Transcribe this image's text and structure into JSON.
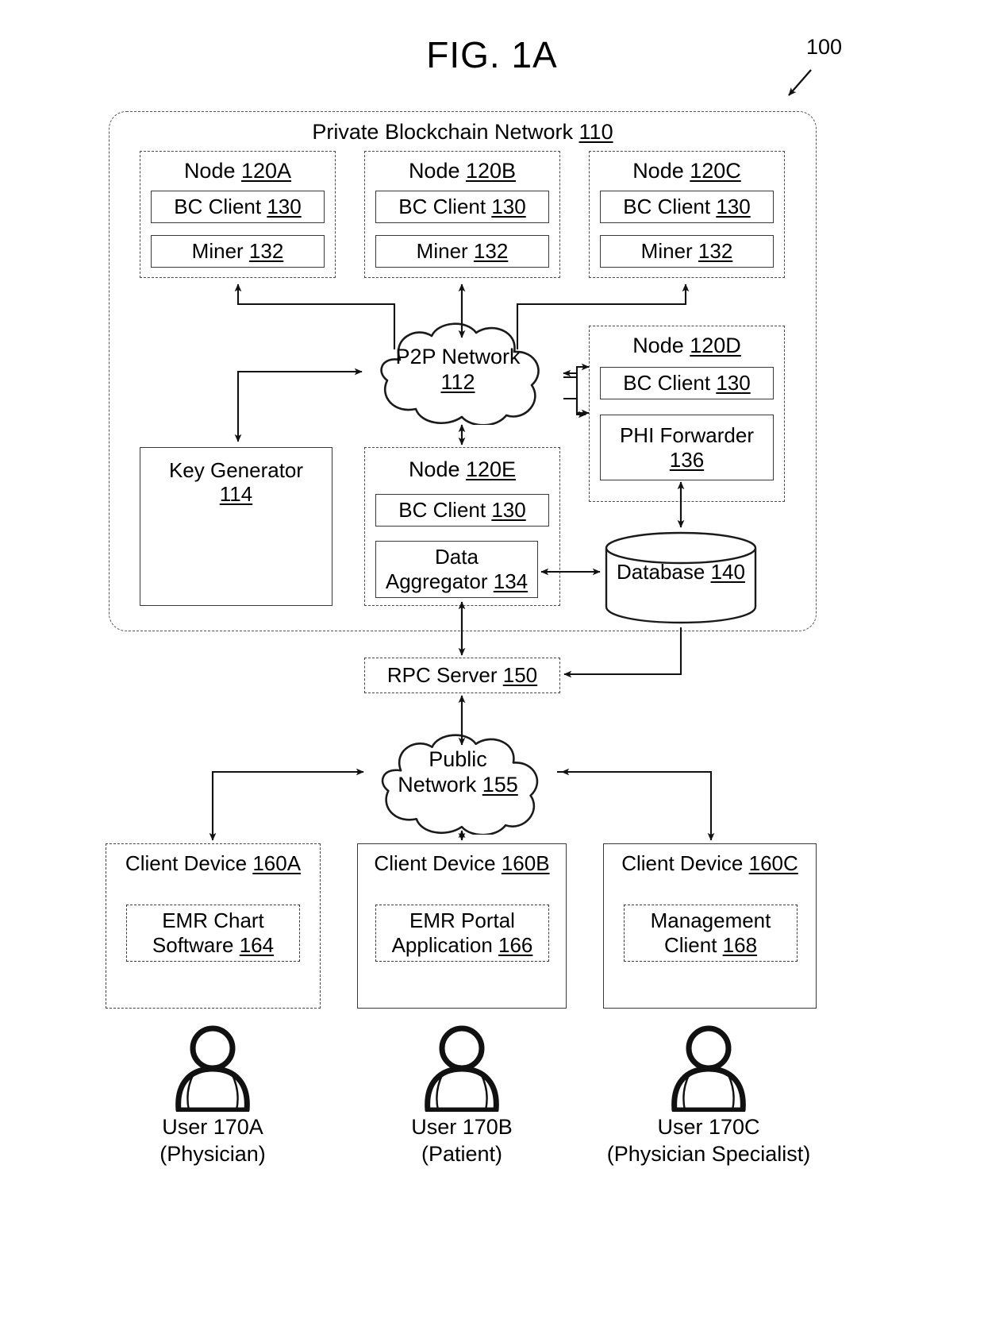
{
  "figure": {
    "title": "FIG. 1A",
    "system_ref": "100"
  },
  "private_network": {
    "label": "Private Blockchain Network ",
    "ref": "110"
  },
  "nodes": [
    {
      "id": "node-120a",
      "title": "Node ",
      "ref": "120A",
      "components": [
        {
          "label": "BC Client ",
          "ref": "130"
        },
        {
          "label": "Miner ",
          "ref": "132"
        }
      ]
    },
    {
      "id": "node-120b",
      "title": "Node ",
      "ref": "120B",
      "components": [
        {
          "label": "BC Client ",
          "ref": "130"
        },
        {
          "label": "Miner ",
          "ref": "132"
        }
      ]
    },
    {
      "id": "node-120c",
      "title": "Node ",
      "ref": "120C",
      "components": [
        {
          "label": "BC Client ",
          "ref": "130"
        },
        {
          "label": "Miner ",
          "ref": "132"
        }
      ]
    },
    {
      "id": "node-120d",
      "title": "Node ",
      "ref": "120D",
      "components": [
        {
          "label": "BC Client ",
          "ref": "130"
        },
        {
          "label": "PHI Forwarder",
          "ref": "136"
        }
      ]
    },
    {
      "id": "node-120e",
      "title": "Node ",
      "ref": "120E",
      "components": [
        {
          "label": "BC Client ",
          "ref": "130"
        },
        {
          "label": "Data Aggregator ",
          "ref": "134"
        }
      ]
    }
  ],
  "p2p_cloud": {
    "label": "P2P Network",
    "ref": "112"
  },
  "key_generator": {
    "label": "Key Generator",
    "ref": "114"
  },
  "phi_forwarder": {
    "label": "PHI Forwarder",
    "ref": "136"
  },
  "data_aggregator": {
    "line1": "Data",
    "line2": "Aggregator ",
    "ref": "134"
  },
  "database": {
    "label": "Database ",
    "ref": "140"
  },
  "rpc_server": {
    "label": "RPC Server ",
    "ref": "150"
  },
  "public_cloud": {
    "line1": "Public",
    "line2": "Network ",
    "ref": "155"
  },
  "client_devices": [
    {
      "title": "Client Device ",
      "ref": "160A",
      "app_line1": "EMR Chart",
      "app_line2": "Software ",
      "app_ref": "164",
      "user_name": "User 170A",
      "user_role": "(Physician)"
    },
    {
      "title": "Client Device ",
      "ref": "160B",
      "app_line1": "EMR Portal",
      "app_line2": "Application ",
      "app_ref": "166",
      "user_name": "User 170B",
      "user_role": "(Patient)"
    },
    {
      "title": "Client Device ",
      "ref": "160C",
      "app_line1": "Management",
      "app_line2": "Client ",
      "app_ref": "168",
      "user_name": "User 170C",
      "user_role": "(Physician Specialist)"
    }
  ],
  "icons": {
    "user": "user-person-icon",
    "cloud": "cloud-icon",
    "database": "database-cylinder-icon",
    "arrow": "arrow-icon"
  },
  "colors": {
    "stroke": "#222222",
    "dashed_stroke": "#4a4a4a",
    "background": "#ffffff"
  }
}
